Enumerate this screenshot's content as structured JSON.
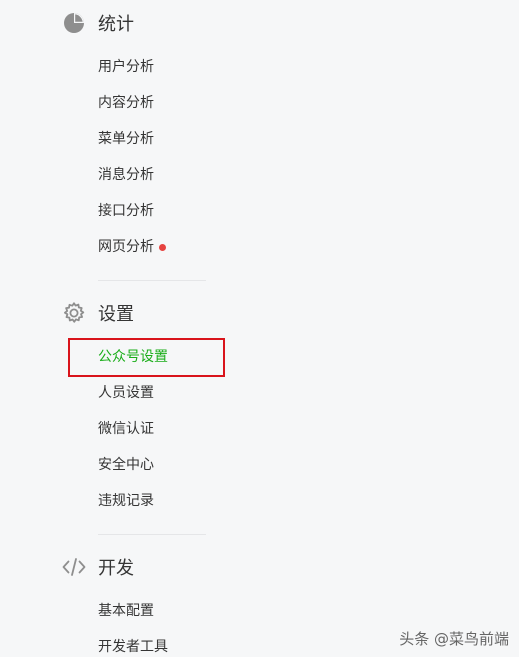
{
  "sidebar": {
    "sections": [
      {
        "title": "统计",
        "icon": "pie-chart-icon",
        "items": [
          {
            "label": "用户分析"
          },
          {
            "label": "内容分析"
          },
          {
            "label": "菜单分析"
          },
          {
            "label": "消息分析"
          },
          {
            "label": "接口分析"
          },
          {
            "label": "网页分析",
            "badge": "red-dot"
          }
        ]
      },
      {
        "title": "设置",
        "icon": "gear-icon",
        "items": [
          {
            "label": "公众号设置",
            "active": true
          },
          {
            "label": "人员设置"
          },
          {
            "label": "微信认证"
          },
          {
            "label": "安全中心"
          },
          {
            "label": "违规记录"
          }
        ]
      },
      {
        "title": "开发",
        "icon": "code-icon",
        "items": [
          {
            "label": "基本配置"
          },
          {
            "label": "开发者工具"
          }
        ]
      }
    ]
  },
  "colors": {
    "active": "#1aad19",
    "highlight_box": "#d9141b",
    "notification_dot": "#e64340",
    "text": "#353535",
    "background": "#f6f7f8"
  },
  "watermark": "头条 @菜鸟前端"
}
